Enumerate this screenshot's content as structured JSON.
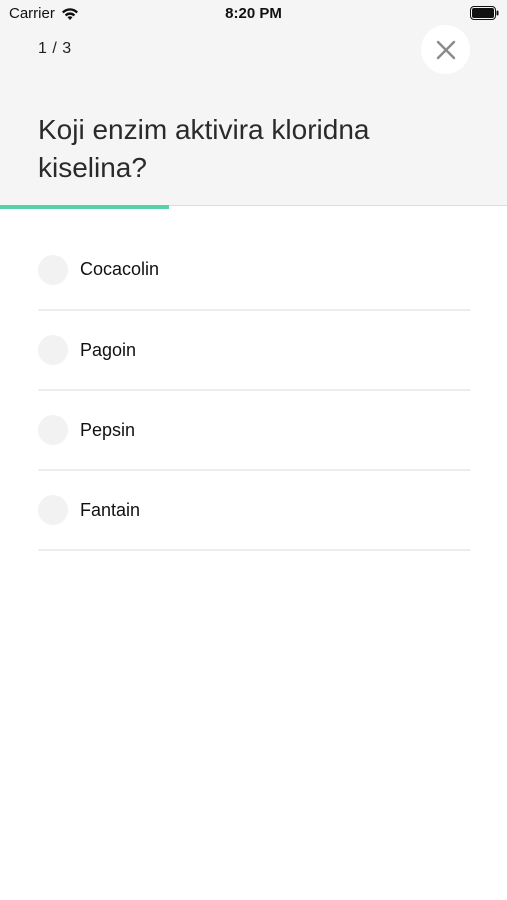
{
  "status_bar": {
    "carrier": "Carrier",
    "time": "8:20 PM"
  },
  "quiz": {
    "progress_text": "1 / 3",
    "progress_fraction": 0.3333,
    "question": "Koji enzim aktivira kloridna kiselina?",
    "answers": [
      {
        "label": "Cocacolin"
      },
      {
        "label": "Pagoin"
      },
      {
        "label": "Pepsin"
      },
      {
        "label": "Fantain"
      }
    ]
  },
  "colors": {
    "accent": "#57d2a6",
    "header_bg": "#f5f5f5",
    "radio_bg": "#f2f2f2"
  },
  "icons": {
    "close": "close-icon",
    "wifi": "wifi-icon",
    "battery": "battery-icon"
  }
}
